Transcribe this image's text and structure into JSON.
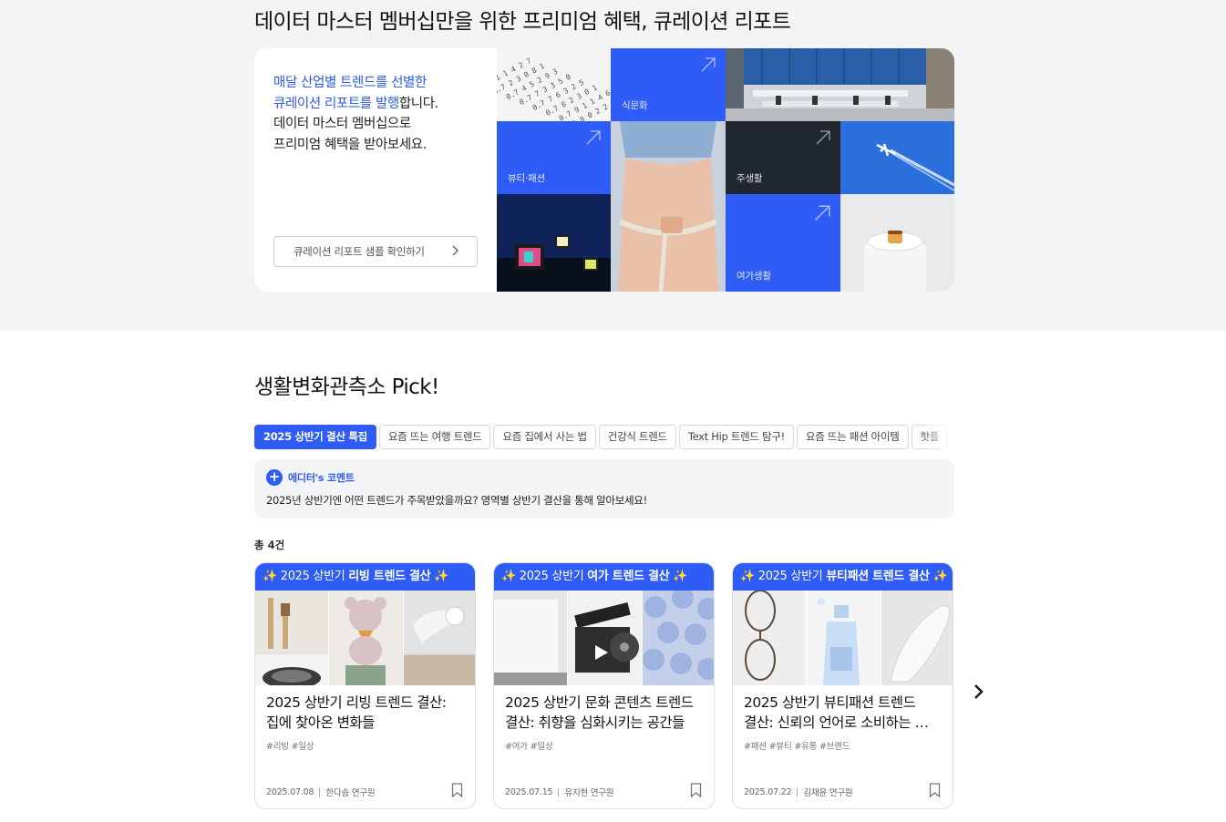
{
  "premium": {
    "section_title": "데이터 마스터 멤버십만을 위한 프리미엄 혜택, 큐레이션 리포트",
    "intro_hl_line1": "매달 산업별 트렌드를 선별한",
    "intro_hl_line2": "큐레이션 리포트를 발행",
    "intro_line2_rest": "합니다.",
    "intro_line3": "데이터 마스터 멤버십으로",
    "intro_line4": "프리미엄 혜택을 받아보세요.",
    "sample_button": "큐레이션 리포트 샘플 확인하기",
    "tile_labels": {
      "food": "식문화",
      "beauty": "뷰티·패션",
      "living": "주생활",
      "leisure": "여가생활"
    }
  },
  "pick": {
    "title": "생활변화관측소 Pick!",
    "tabs": [
      "2025 상반기 결산 특집",
      "요즘 뜨는 여행 트렌드",
      "요즘 집에서 사는 법",
      "건강식 트렌드",
      "Text Hip 트렌드 탐구!",
      "요즘 뜨는 패션 아이템",
      "핫플"
    ],
    "editor_label": "에디터's 코멘트",
    "editor_comment": "2025년 상반기엔 어떤 트렌드가 주목받았을까요? 영역별 상반기 결산을 통해 알아보세요!",
    "total": "총 4건",
    "cards": [
      {
        "banner_prefix": "✨ 2025 상반기 ",
        "banner_bold": "리빙 트렌드 결산",
        "banner_suffix": " ✨",
        "title_line1": "2025 상반기 리빙 트렌드 결산:",
        "title_line2": "집에 찾아온 변화들",
        "tags": "#리빙 #일상",
        "date": "2025.07.08",
        "author": "한다솜 연구원"
      },
      {
        "banner_prefix": "✨ 2025 상반기 ",
        "banner_bold": "여가 트렌드 결산",
        "banner_suffix": " ✨",
        "title_line1": "2025 상반기 문화 콘텐츠 트렌드",
        "title_line2": "결산: 취향을 심화시키는 공간들",
        "tags": "#여가 #일상",
        "date": "2025.07.15",
        "author": "유지현 연구원"
      },
      {
        "banner_prefix": "✨ 2025 상반기 ",
        "banner_bold": "뷰티패션 트렌드 결산",
        "banner_suffix": " ✨",
        "title_line1": "2025 상반기 뷰티패션 트렌드",
        "title_line2": "결산: 신뢰의 언어로 소비하는 …",
        "tags": "#패션 #뷰티 #유통 #브랜드",
        "date": "2025.07.22",
        "author": "김채윤 연구원"
      }
    ]
  },
  "colors": {
    "accent": "#2f5cf6",
    "top_bg": "#f3f4f6",
    "dark_tile": "#20272f"
  },
  "icons": [
    "arrow-up-right-icon",
    "chevron-right-icon",
    "plus-icon",
    "bookmark-icon"
  ]
}
